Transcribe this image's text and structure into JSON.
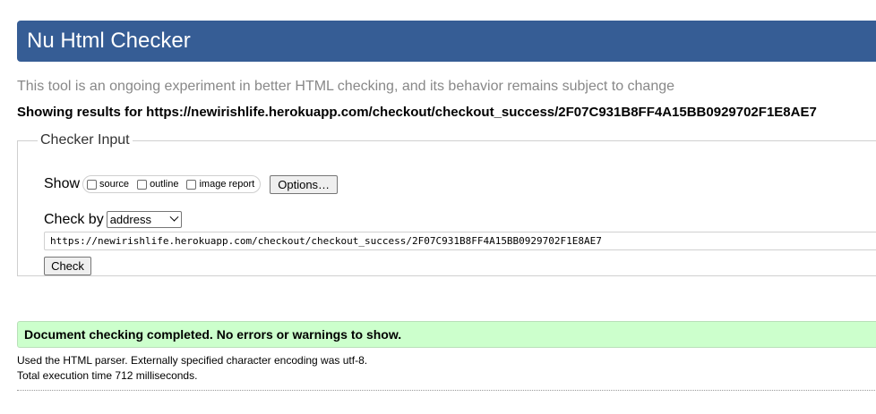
{
  "header": {
    "title": "Nu Html Checker"
  },
  "tagline": "This tool is an ongoing experiment in better HTML checking, and its behavior remains subject to change",
  "showing_results": "Showing results for https://newirishlife.herokuapp.com/checkout/checkout_success/2F07C931B8FF4A15BB0929702F1E8AE7",
  "checker_input": {
    "legend": "Checker Input",
    "show_label": "Show",
    "options": [
      {
        "label": "source",
        "checked": false
      },
      {
        "label": "outline",
        "checked": false
      },
      {
        "label": "image report",
        "checked": false
      }
    ],
    "options_button": "Options…",
    "check_by_label": "Check by",
    "check_by_value": "address",
    "url_value": "https://newirishlife.herokuapp.com/checkout/checkout_success/2F07C931B8FF4A15BB0929702F1E8AE7",
    "check_button": "Check"
  },
  "result": {
    "success_message": "Document checking completed. No errors or warnings to show.",
    "parser_info": "Used the HTML parser. Externally specified character encoding was utf-8.",
    "execution_time": "Total execution time 712 milliseconds."
  },
  "colors": {
    "header_bg": "#365d95",
    "success_bg": "#ccffcc",
    "tagline": "#888888"
  }
}
